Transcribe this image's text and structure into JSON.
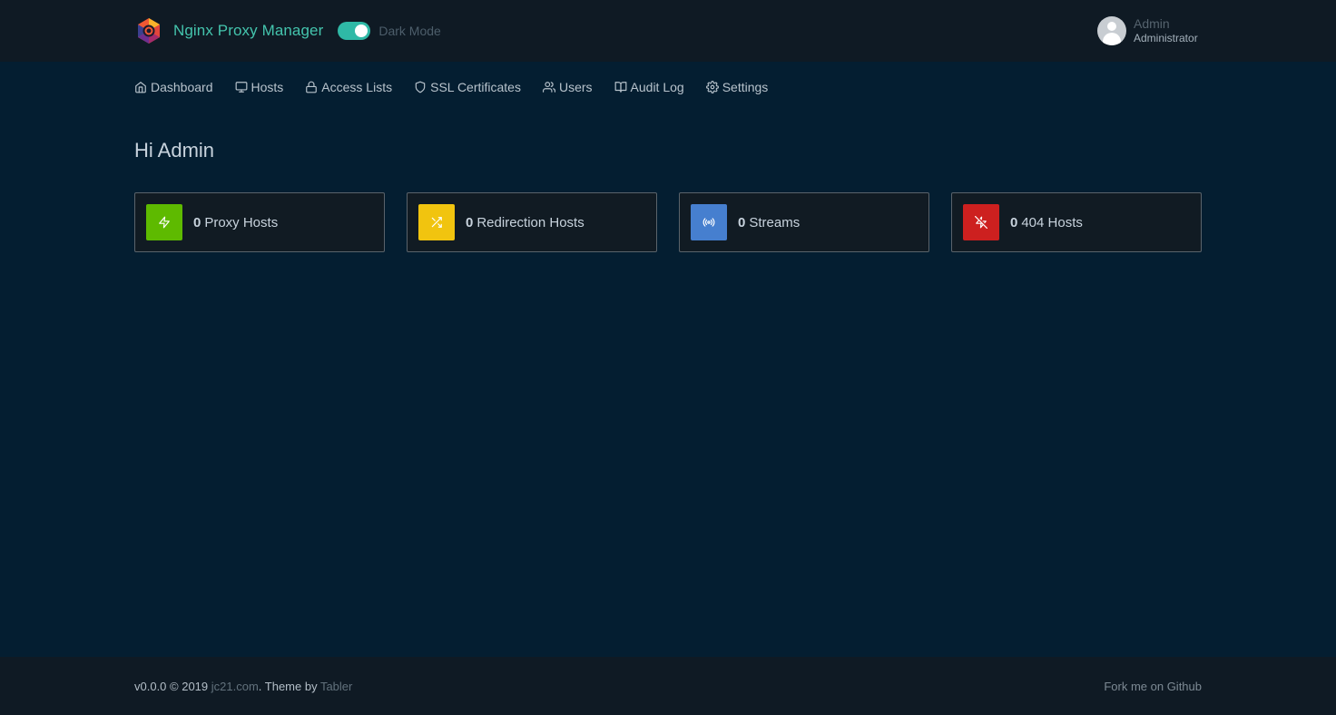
{
  "header": {
    "brand": "Nginx Proxy Manager",
    "dark_mode_label": "Dark Mode",
    "dark_mode_on": true,
    "user_name": "Admin",
    "user_role": "Administrator"
  },
  "nav": [
    {
      "label": "Dashboard",
      "icon": "home-icon"
    },
    {
      "label": "Hosts",
      "icon": "monitor-icon"
    },
    {
      "label": "Access Lists",
      "icon": "lock-icon"
    },
    {
      "label": "SSL Certificates",
      "icon": "shield-icon"
    },
    {
      "label": "Users",
      "icon": "users-icon"
    },
    {
      "label": "Audit Log",
      "icon": "book-icon"
    },
    {
      "label": "Settings",
      "icon": "gear-icon"
    }
  ],
  "greeting": "Hi Admin",
  "cards": [
    {
      "count": "0",
      "label": "Proxy Hosts",
      "icon": "zap-icon",
      "color": "#5eba00"
    },
    {
      "count": "0",
      "label": "Redirection Hosts",
      "icon": "shuffle-icon",
      "color": "#f1c40f"
    },
    {
      "count": "0",
      "label": "Streams",
      "icon": "radio-icon",
      "color": "#467fcf"
    },
    {
      "count": "0",
      "label": "404 Hosts",
      "icon": "zap-off-icon",
      "color": "#cd201f"
    }
  ],
  "footer": {
    "prefix": "v0.0.0 © 2019 ",
    "link1": "jc21.com",
    "middle": ". Theme by ",
    "link2": "Tabler",
    "right": "Fork me on Github"
  },
  "colors": {
    "accent": "#44c4ad",
    "background": "#041e31",
    "header_bg": "#0f1a24"
  }
}
